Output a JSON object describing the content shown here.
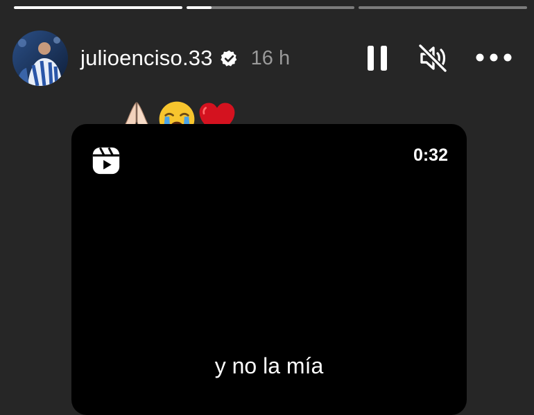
{
  "story": {
    "progress": [
      1.0,
      0.15,
      0.0
    ]
  },
  "header": {
    "username": "julioenciso.33",
    "verified": true,
    "time": "16 h",
    "avatar_icon": "profile-avatar",
    "pause_icon": "pause-icon",
    "mute_icon": "speaker-muted-icon",
    "more_icon": "more-dots-icon"
  },
  "reaction": {
    "emojis": [
      "folded-hands",
      "loudly-crying-face",
      "red-heart"
    ]
  },
  "reel": {
    "icon": "reels-icon",
    "duration": "0:32",
    "caption": "y no la mía"
  },
  "colors": {
    "background": "#262626",
    "card": "#000000",
    "muted_text": "#9a9a9a",
    "heart": "#d4121f"
  }
}
